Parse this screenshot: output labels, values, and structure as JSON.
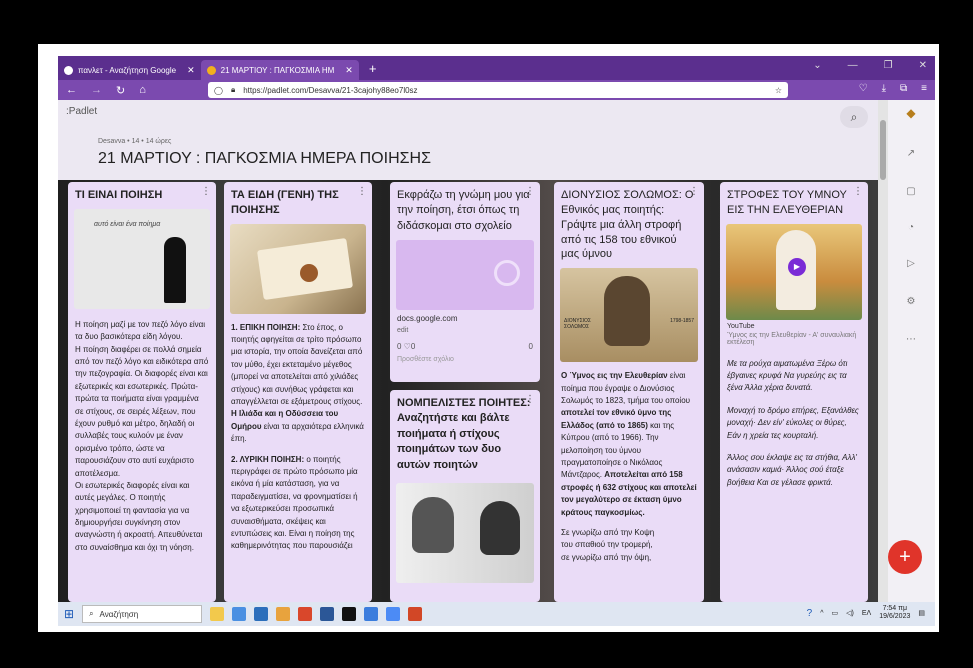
{
  "browser": {
    "tabs": [
      {
        "label": "πανλετ - Αναζήτηση Google",
        "active": false
      },
      {
        "label": "21 ΜΑΡΤΙΟΥ : ΠΑΓΚΟΣΜΙΑ ΗΜ",
        "active": true
      }
    ],
    "url": "https://padlet.com/Desavva/21-3cajohy88eo7l0sz"
  },
  "padlet": {
    "logo": ":Padlet",
    "meta": "Desavva • 14 • 14 ώρες",
    "title": "21 ΜΑΡΤΙΟΥ : ΠΑΓΚΟΣΜΙΑ ΗΜΕΡΑ ΠΟΙΗΣΗΣ"
  },
  "columns": [
    {
      "title": "ΤΙ ΕΙΝΑΙ ΠΟΙΗΣΗ",
      "image_caption": "αυτό είναι ένα ποίημα",
      "body": [
        "Η ποίηση μαζί με τον πεζό λόγο είναι τα δυο βασικότερα είδη λόγου.",
        "Η ποίηση διαφέρει σε πολλά σημεία από τον πεζό λόγο και ειδικότερα από την πεζογραφία. Οι διαφορές είναι και εξωτερικές και εσωτερικές. Πρώτα-πρώτα τα ποιήματα είναι γραμμένα σε στίχους, σε σειρές λέξεων, που έχουν ρυθμό και μέτρο, δηλαδή οι συλλαβές τους κυλούν με έναν ορισμένο τρόπο, ώστε να παρουσιάζουν στο αυτί ευχάριστο αποτέλεσμα.",
        "Οι εσωτερικές διαφορές είναι και αυτές μεγάλες. Ο ποιητής χρησιμοποιεί τη φαντασία για να δημιουργήσει συγκίνηση στον αναγνώστη ή ακροατή. Απευθύνεται στο συναίσθημα και όχι τη νόηση."
      ]
    },
    {
      "title": "ΤΑ ΕΙΔΗ (ΓΕΝΗ) ΤΗΣ ΠΟΙΗΣΗΣ",
      "p1_bold": "1. ΕΠΙΚΗ ΠΟΙΗΣΗ:",
      "p1_text": " Στο έπος, ο ποιητής αφηγείται σε τρίτο πρόσωπο μια ιστορία, την οποία δανείζεται από τον μύθο, έχει εκτεταμένο μέγεθος (μπορεί να αποτελείται από χιλιάδες στίχους) και συνήθως γράφεται και απαγγέλλεται σε εξάμετρους στίχους. ",
      "p1_bold2": "Η Ιλιάδα και η Οδύσσεια του Ομήρου",
      "p1_text2": " είναι τα αρχαιότερα ελληνικά έπη.",
      "p2_bold": "2. ΛΥΡΙΚΗ ΠΟΙΗΣΗ:",
      "p2_text": " ο ποιητής περιγράφει σε πρώτο πρόσωπο μία εικόνα ή μία κατάσταση, για να παραδειγματίσει, να φρονηματίσει ή να εξωτερικεύσει προσωπικά συναισθήματα, σκέψεις και εντυπώσεις και. Είναι η ποίηση της καθημερινότητας που παρουσιάζει"
    },
    {
      "title": "Εκφράζω τη γνώμη μου για την ποίηση, έτσι όπως τη διδάσκομαι στο σχολείο",
      "link_domain": "docs.google.com",
      "link_label": "edit",
      "reactions": "0 ♡0",
      "comments": "0",
      "add_comment": "Προσθέστε σχόλιο"
    },
    {
      "title": "ΝΟΜΠΕΛΙΣΤΕΣ ΠΟΙΗΤΕΣ: Αναζητήστε και βάλτε ποιήματα ή στίχους ποιημάτων των δυο αυτών ποιητών"
    },
    {
      "title": "ΔΙΟΝΥΣΙΟΣ ΣΟΛΩΜΟΣ: Ο Εθνικός μας ποιητής: Γράψτε μια άλλη στροφή από τις 158 του εθνικού μας ύμνου",
      "portrait_label_left": "ΔΙΟΝΥΣΙΟΣ ΣΟΛΩΜΟΣ",
      "portrait_label_right": "1798-1857",
      "b1": "Ο Ύμνος εις την Ελευθερίαν",
      "t1": " είναι ποίημα που έγραψε ο Διονύσιος Σολωμός το 1823, τμήμα του οποίου ",
      "b2": "αποτελεί τον εθνικό ύμνο της Ελλάδος (από το 1865)",
      "t2": " και της Κύπρου (από το 1966). Την μελοποίηση του ύμνου πραγματοποίησε ο Νικόλαος Μάντζαρος. ",
      "b3": "Αποτελείται από 158 στροφές ή 632 στίχους και αποτελεί τον μεγαλύτερο σε έκταση ύμνο κράτους παγκοσμίως.",
      "verse": "Σε γνωρίζω από την Κοψη\n του σπαθιού την τρομερή,\n σε γνωρίζω από την όψη,"
    },
    {
      "title": "ΣΤΡΟΦΕΣ ΤΟΥ ΥΜΝΟΥ ΕΙΣ ΤΗΝ ΕΛΕΥΘΕΡΙΑΝ",
      "video_source": "YouTube",
      "video_caption": "Ύμνος εις την Ελευθερίαν - Α' συναυλιακή εκτέλεση",
      "verses": [
        "Με τα ρούχα αιματωμένα Ξέρω ότι έβγαινες κρυφά Να γυρεύης εις τα ξένα Άλλα χέρια δυνατά.",
        "Μοναχή το δρόμο επήρες, Εξανάλθες μοναχή· Δεν είν' εύκολες οι θύρες, Εάν η χρεία τες κουρταλή.",
        "Άλλος σου έκλαψε εις τα στήθια, Αλλ' ανάσασιν καμιά· Άλλος σού έταξε βοήθεια Και σε γέλασε φρικτά."
      ]
    }
  ],
  "taskbar": {
    "search_placeholder": "Αναζήτηση",
    "lang": "ΕΛ",
    "time": "7:54 πμ",
    "date": "19/6/2023"
  },
  "colors": {
    "accent": "#7b4aaf",
    "card": "#eadcf7",
    "fab": "#e0342a"
  }
}
